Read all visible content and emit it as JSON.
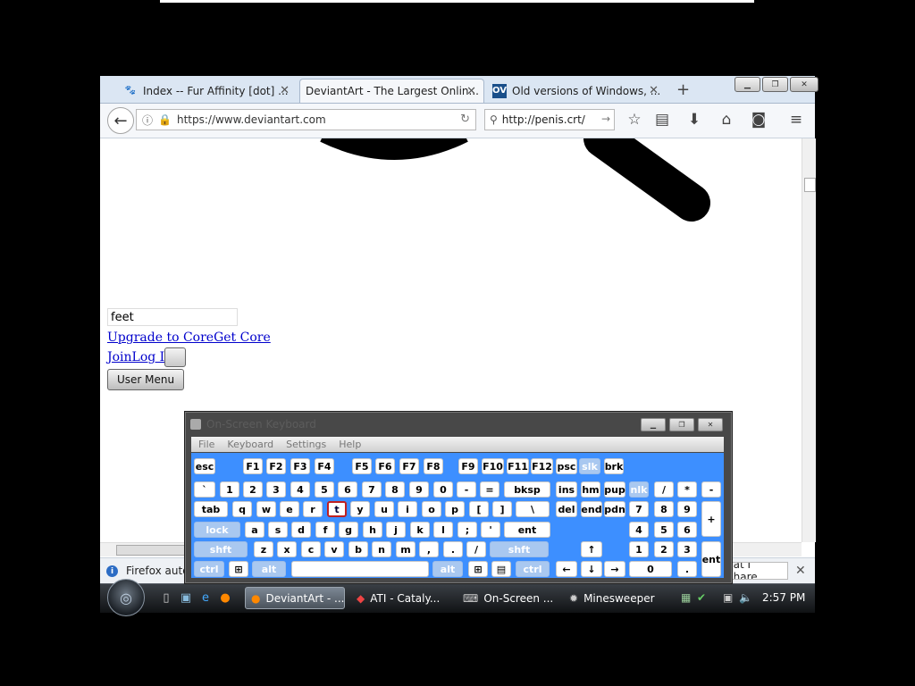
{
  "browser": {
    "tabs": [
      {
        "label": "Index -- Fur Affinity [dot] ...",
        "icon": "paw-icon"
      },
      {
        "label": "DeviantArt - The Largest Onlin...",
        "icon": "none"
      },
      {
        "label": "Old versions of Windows, ...",
        "icon": "ov-icon",
        "icon_text": "OV"
      }
    ],
    "url": "https://www.deviantart.com",
    "search_value": "http://penis.crt/"
  },
  "page": {
    "search_value": "feet",
    "link_upgrade": "Upgrade to CoreGet Core",
    "link_join": "JoinLog In",
    "user_menu": "User Menu"
  },
  "notification": {
    "text": "Firefox autor",
    "button": "hat I Share"
  },
  "taskbar": {
    "items": [
      {
        "label": "DeviantArt - ...",
        "active": true
      },
      {
        "label": "ATI - Cataly...",
        "active": false
      },
      {
        "label": "On-Screen ...",
        "active": false
      },
      {
        "label": "Minesweeper",
        "active": false
      }
    ],
    "clock": "2:57 PM"
  },
  "osk": {
    "title": "On-Screen Keyboard",
    "menu": [
      "File",
      "Keyboard",
      "Settings",
      "Help"
    ],
    "rows": {
      "r1": [
        "esc",
        "F1",
        "F2",
        "F3",
        "F4",
        "F5",
        "F6",
        "F7",
        "F8",
        "F9",
        "F10",
        "F11",
        "F12",
        "psc",
        "slk",
        "brk"
      ],
      "r2": [
        "`",
        "1",
        "2",
        "3",
        "4",
        "5",
        "6",
        "7",
        "8",
        "9",
        "0",
        "-",
        "=",
        "bksp",
        "ins",
        "hm",
        "pup",
        "nlk",
        "/",
        "*",
        "-"
      ],
      "r3": [
        "tab",
        "q",
        "w",
        "e",
        "r",
        "t",
        "y",
        "u",
        "i",
        "o",
        "p",
        "[",
        "]",
        "\\",
        "del",
        "end",
        "pdn",
        "7",
        "8",
        "9",
        "+"
      ],
      "r4": [
        "lock",
        "a",
        "s",
        "d",
        "f",
        "g",
        "h",
        "j",
        "k",
        "l",
        ";",
        "'",
        "ent",
        "4",
        "5",
        "6"
      ],
      "r5": [
        "shft",
        "z",
        "x",
        "c",
        "v",
        "b",
        "n",
        "m",
        ",",
        ".",
        "/",
        "shft",
        "↑",
        "1",
        "2",
        "3",
        "ent"
      ],
      "r6": [
        "ctrl",
        "⊞",
        "alt",
        "",
        "alt",
        "⊞",
        "▤",
        "ctrl",
        "←",
        "↓",
        "→",
        "0",
        "."
      ]
    },
    "pressed_key": "t"
  }
}
